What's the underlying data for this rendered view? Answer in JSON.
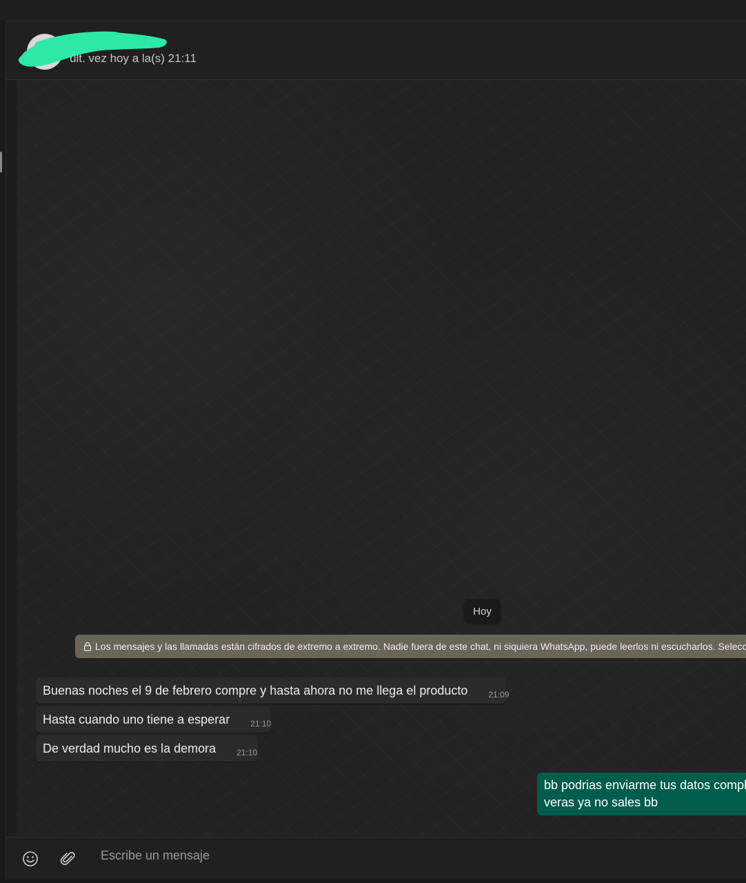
{
  "header": {
    "contact_status": "últ. vez hoy a la(s) 21:11"
  },
  "chat": {
    "date_chip": "Hoy",
    "encryption_notice": "Los mensajes y las llamadas están cifrados de extremo a extremo. Nadie fuera de este chat, ni siquiera WhatsApp, puede leerlos ni escucharlos. Selecciona",
    "incoming": [
      {
        "text": "Buenas noches el 9 de febrero compre y hasta ahora no me llega el producto",
        "time": "21:09"
      },
      {
        "text": "Hasta cuando uno tiene a esperar",
        "time": "21:10"
      },
      {
        "text": "De verdad mucho es la demora",
        "time": "21:10"
      }
    ],
    "outgoing": {
      "lines": [
        "bb podrias enviarme tus datos comple",
        "veras ya no sales bb"
      ]
    }
  },
  "composer": {
    "placeholder": "Escribe un mensaje",
    "emoji_icon": "emoji-icon",
    "attach_icon": "paperclip-icon"
  },
  "colors": {
    "outgoing_bubble": "#005c4b",
    "incoming_bubble": "#2b2b2b",
    "encryption_notice_bg": "#6b6459",
    "redaction_marker": "#2ee8a8"
  }
}
